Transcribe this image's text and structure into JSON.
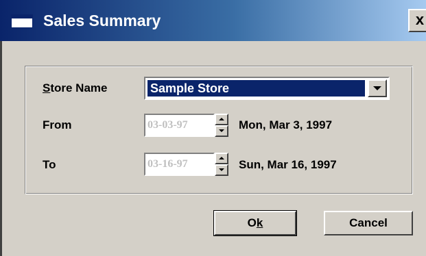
{
  "window": {
    "title": "Sales Summary",
    "close_label": "x"
  },
  "form": {
    "store_label_first": "S",
    "store_label_rest": "tore Name",
    "store_value": "Sample Store",
    "from_label": "From",
    "from_date": "03-03-97",
    "from_text": "Mon, Mar 3, 1997",
    "to_label": "To",
    "to_date": "03-16-97",
    "to_text": "Sun, Mar 16, 1997"
  },
  "buttons": {
    "ok_first": "O",
    "ok_mnemonic": "k",
    "cancel": "Cancel"
  },
  "colors": {
    "selection": "#0a246a",
    "face": "#d4d0c8",
    "disabled_text": "#c0c0c0"
  }
}
